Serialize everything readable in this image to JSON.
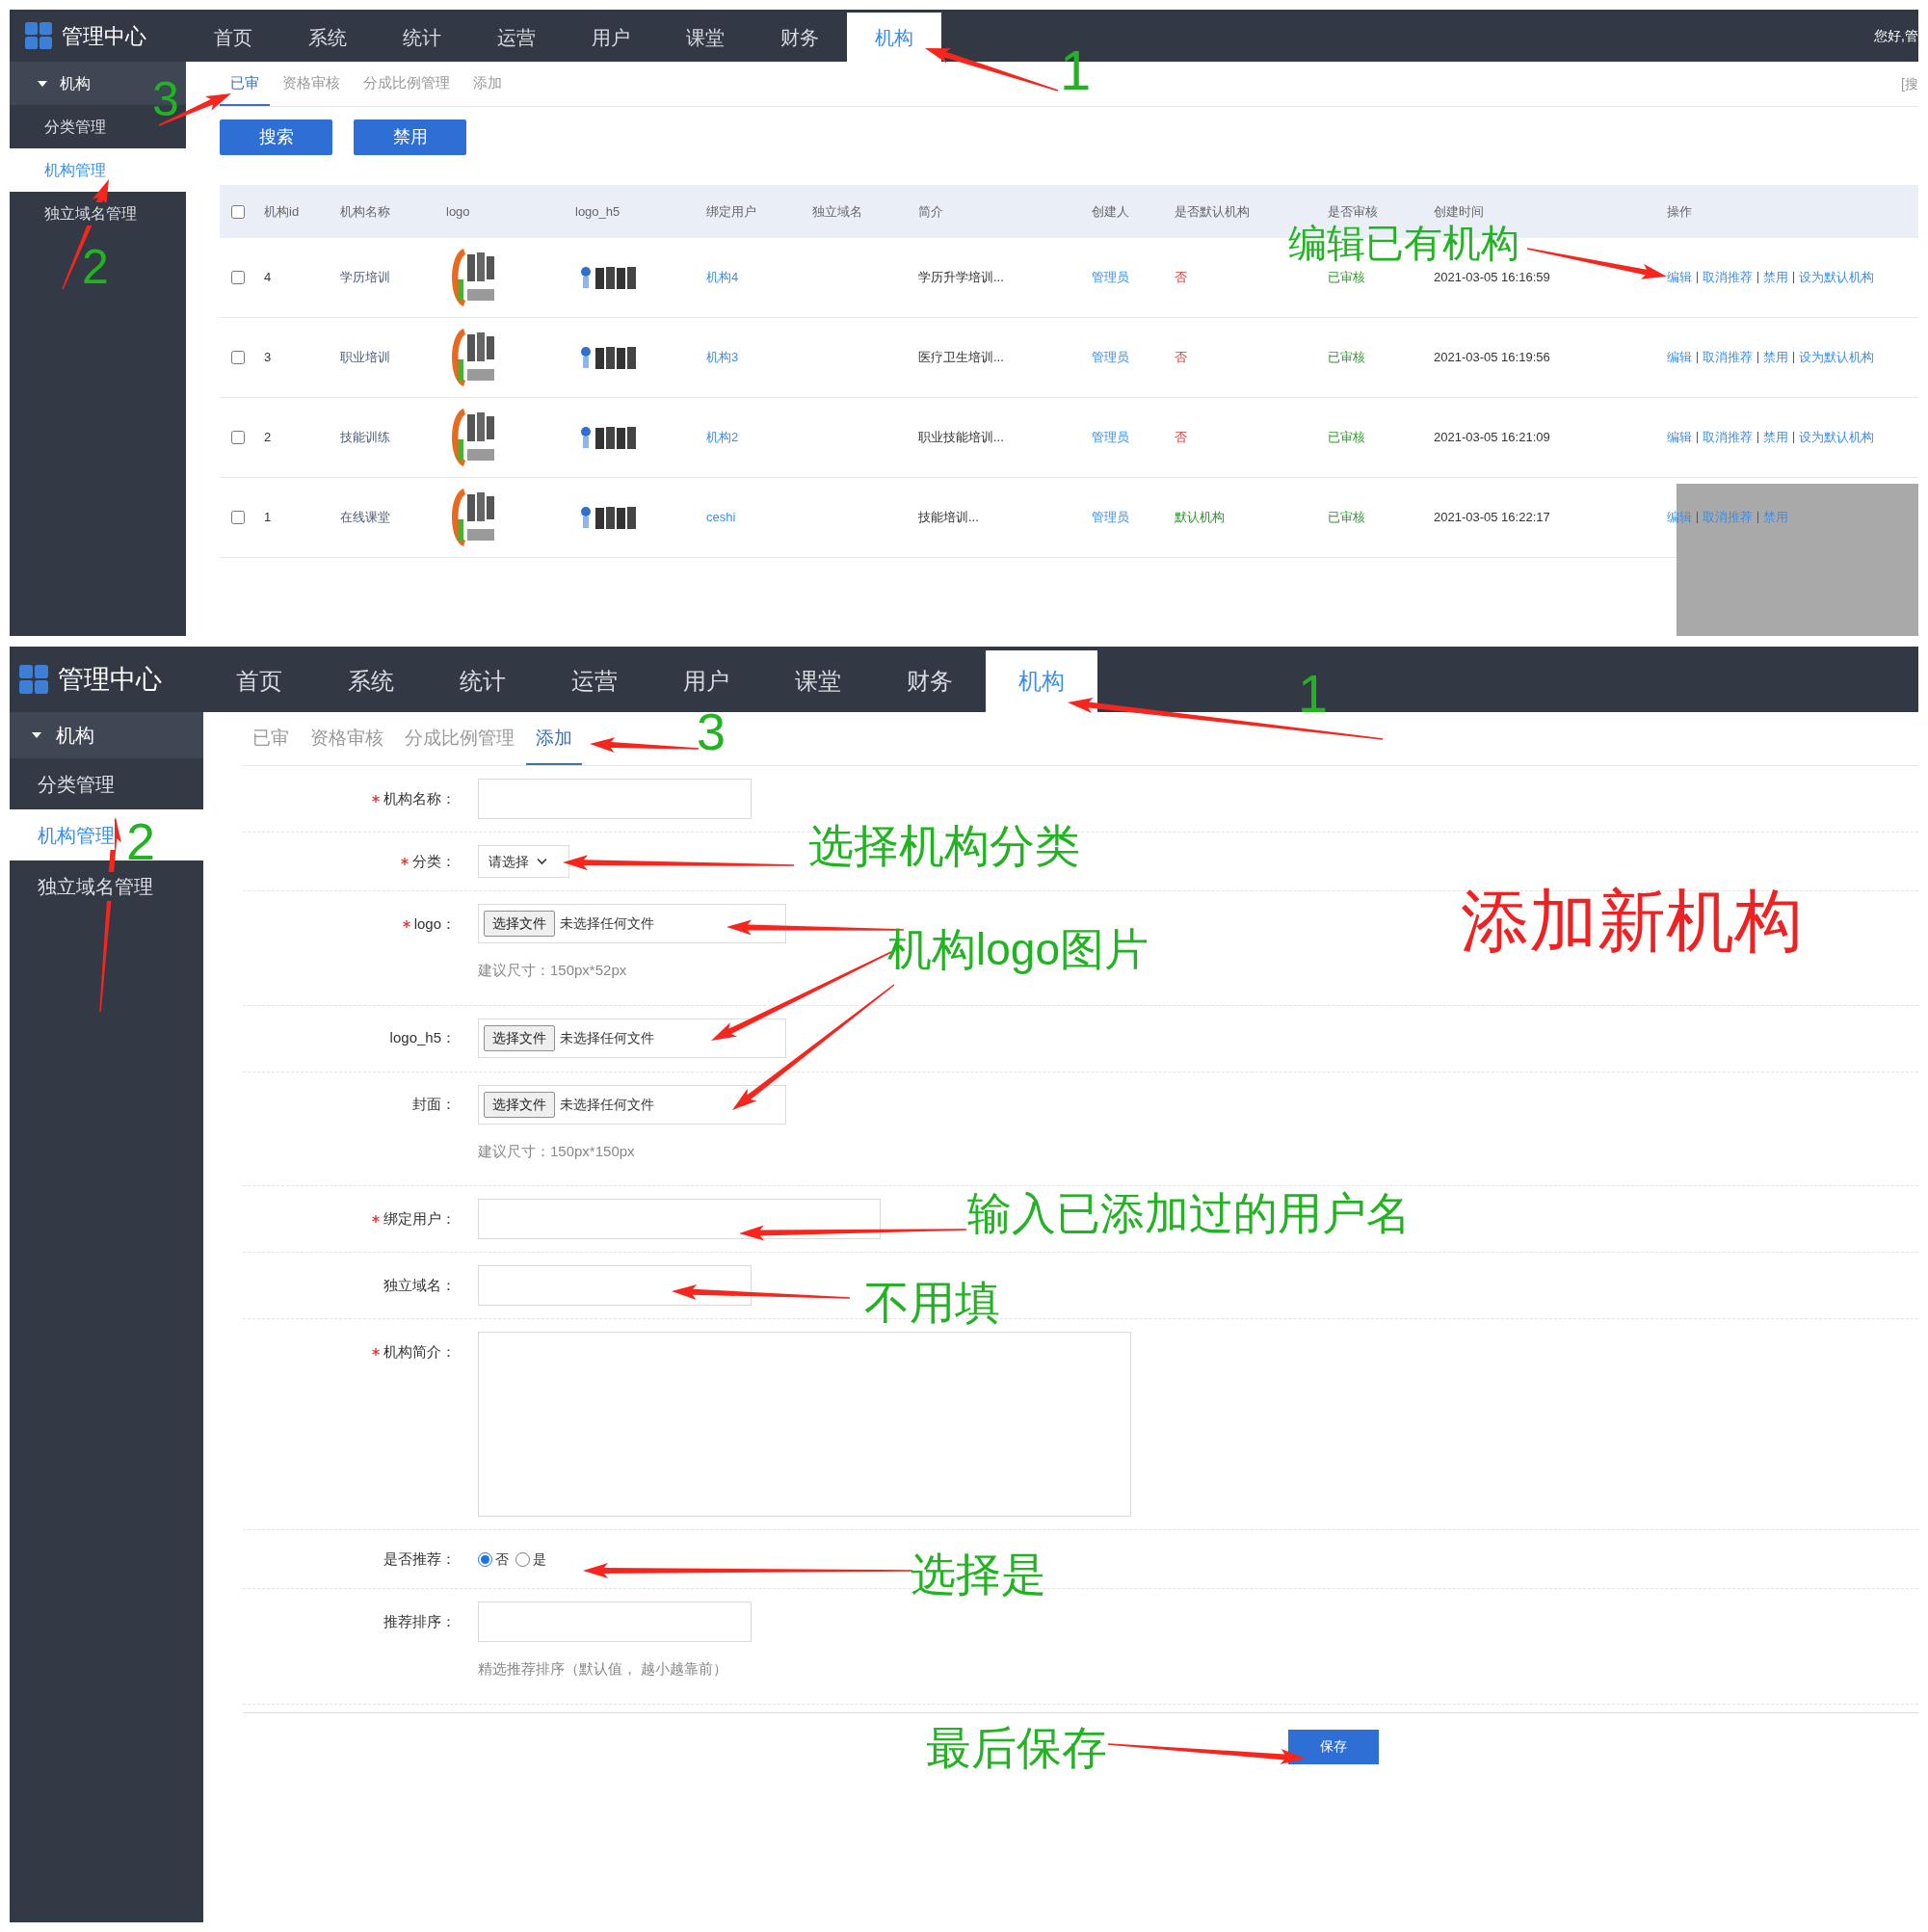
{
  "top_screen": {
    "brand": "管理中心",
    "nav": [
      {
        "label": "首页",
        "selected": false
      },
      {
        "label": "系统",
        "selected": false
      },
      {
        "label": "统计",
        "selected": false
      },
      {
        "label": "运营",
        "selected": false
      },
      {
        "label": "用户",
        "selected": false
      },
      {
        "label": "课堂",
        "selected": false
      },
      {
        "label": "财务",
        "selected": false
      },
      {
        "label": "机构",
        "selected": true
      }
    ],
    "greeting": "您好,管",
    "sidebar": {
      "group": {
        "label": "机构",
        "expanded": true
      },
      "items": [
        {
          "label": "分类管理",
          "selected": false
        },
        {
          "label": "机构管理",
          "selected": true
        },
        {
          "label": "独立域名管理",
          "selected": false
        }
      ]
    },
    "subtabs": [
      {
        "label": "已审",
        "selected": true
      },
      {
        "label": "资格审核",
        "selected": false
      },
      {
        "label": "分成比例管理",
        "selected": false
      },
      {
        "label": "添加",
        "selected": false
      }
    ],
    "search_link": "[搜",
    "buttons": [
      "搜索",
      "禁用"
    ],
    "table": {
      "select_all": false,
      "columns": [
        "机构id",
        "机构名称",
        "logo",
        "logo_h5",
        "绑定用户",
        "独立域名",
        "简介",
        "创建人",
        "是否默认机构",
        "是否审核",
        "创建时间",
        "操作"
      ],
      "rows": [
        {
          "checked": false,
          "id": "4",
          "name": "学历培训",
          "bound_user": "机构4",
          "intro": "学历升学培训...",
          "creator": "管理员",
          "is_default": "否",
          "default": false,
          "review": "已审核",
          "created": "2021-03-05 16:16:59",
          "actions": [
            "编辑",
            "取消推荐",
            "禁用",
            "设为默认机构"
          ]
        },
        {
          "checked": false,
          "id": "3",
          "name": "职业培训",
          "bound_user": "机构3",
          "intro": "医疗卫生培训...",
          "creator": "管理员",
          "is_default": "否",
          "default": false,
          "review": "已审核",
          "created": "2021-03-05 16:19:56",
          "actions": [
            "编辑",
            "取消推荐",
            "禁用",
            "设为默认机构"
          ]
        },
        {
          "checked": false,
          "id": "2",
          "name": "技能训练",
          "bound_user": "机构2",
          "intro": "职业技能培训...",
          "creator": "管理员",
          "is_default": "否",
          "default": false,
          "review": "已审核",
          "created": "2021-03-05 16:21:09",
          "actions": [
            "编辑",
            "取消推荐",
            "禁用",
            "设为默认机构"
          ]
        },
        {
          "checked": false,
          "id": "1",
          "name": "在线课堂",
          "bound_user": "ceshi",
          "intro": "技能培训...",
          "creator": "管理员",
          "is_default": "默认机构",
          "default": true,
          "review": "已审核",
          "created": "2021-03-05 16:22:17",
          "actions": [
            "编辑",
            "取消推荐",
            "禁用"
          ]
        }
      ]
    }
  },
  "bottom_screen": {
    "brand": "管理中心",
    "nav": [
      {
        "label": "首页",
        "selected": false
      },
      {
        "label": "系统",
        "selected": false
      },
      {
        "label": "统计",
        "selected": false
      },
      {
        "label": "运营",
        "selected": false
      },
      {
        "label": "用户",
        "selected": false
      },
      {
        "label": "课堂",
        "selected": false
      },
      {
        "label": "财务",
        "selected": false
      },
      {
        "label": "机构",
        "selected": true
      }
    ],
    "sidebar": {
      "group": {
        "label": "机构",
        "expanded": true
      },
      "items": [
        {
          "label": "分类管理",
          "selected": false
        },
        {
          "label": "机构管理",
          "selected": true
        },
        {
          "label": "独立域名管理",
          "selected": false
        }
      ]
    },
    "subtabs": [
      {
        "label": "已审",
        "selected": false
      },
      {
        "label": "资格审核",
        "selected": false
      },
      {
        "label": "分成比例管理",
        "selected": false
      },
      {
        "label": "添加",
        "selected": true
      }
    ],
    "form": [
      {
        "kind": "text",
        "label": "机构名称：",
        "required": true
      },
      {
        "kind": "select",
        "label": "分类：",
        "required": true,
        "value": "请选择"
      },
      {
        "kind": "file",
        "label": "logo：",
        "required": true,
        "button": "选择文件",
        "status": "未选择任何文件",
        "hint": "建议尺寸：150px*52px"
      },
      {
        "kind": "file",
        "label": "logo_h5：",
        "required": false,
        "button": "选择文件",
        "status": "未选择任何文件"
      },
      {
        "kind": "file",
        "label": "封面：",
        "required": false,
        "button": "选择文件",
        "status": "未选择任何文件",
        "hint": "建议尺寸：150px*150px"
      },
      {
        "kind": "wide_text",
        "label": "绑定用户：",
        "required": true
      },
      {
        "kind": "text",
        "label": "独立域名：",
        "required": false
      },
      {
        "kind": "textarea",
        "label": "机构简介：",
        "required": true
      },
      {
        "kind": "radio",
        "label": "是否推荐：",
        "required": false,
        "options": [
          {
            "label": "否",
            "selected": true
          },
          {
            "label": "是",
            "selected": false
          }
        ]
      },
      {
        "kind": "text",
        "label": "推荐排序：",
        "required": false,
        "hint": "精选推荐排序（默认值， 越小越靠前）"
      }
    ],
    "save_button": "保存"
  },
  "annotations": [
    {
      "text": "1",
      "color": "#22b322"
    },
    {
      "text": "3",
      "color": "#22b322"
    },
    {
      "text": "编辑已有机构",
      "color": "#22b322"
    },
    {
      "text": "2",
      "color": "#22b322"
    },
    {
      "text": "1",
      "color": "#22b322"
    },
    {
      "text": "3",
      "color": "#22b322"
    },
    {
      "text": "2",
      "color": "#22b322"
    },
    {
      "text": "选择机构分类",
      "color": "#22b322"
    },
    {
      "text": "添加新机构",
      "color": "#ee2222"
    },
    {
      "text": "机构logo图片",
      "color": "#22b322"
    },
    {
      "text": "输入已添加过的用户名",
      "color": "#22b322"
    },
    {
      "text": "不用填",
      "color": "#22b322"
    },
    {
      "text": "选择是",
      "color": "#22b322"
    },
    {
      "text": "最后保存",
      "color": "#22b322"
    }
  ]
}
